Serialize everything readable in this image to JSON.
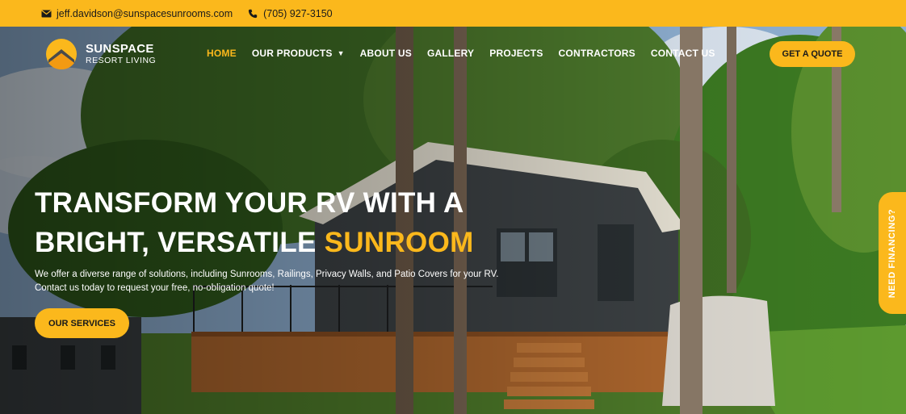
{
  "topbar": {
    "email": "jeff.davidson@sunspacesunrooms.com",
    "phone": "(705) 927-3150",
    "email_icon": "envelope-icon",
    "phone_icon": "phone-icon"
  },
  "logo": {
    "brand": "SUNSPACE",
    "sub": "RESORT LIVING"
  },
  "nav": {
    "items": [
      {
        "label": "HOME"
      },
      {
        "label": "OUR PRODUCTS"
      },
      {
        "label": "ABOUT US"
      },
      {
        "label": "GALLERY"
      },
      {
        "label": "PROJECTS"
      },
      {
        "label": "CONTRACTORS"
      },
      {
        "label": "CONTACT US"
      }
    ],
    "cta": "GET A QUOTE"
  },
  "hero": {
    "headline_line1": "TRANSFORM YOUR RV WITH A",
    "headline_line2_prefix": "BRIGHT, VERSATILE ",
    "headline_accent": "SUNROOM",
    "description": "We offer a diverse range of solutions, including Sunrooms, Railings, Privacy Walls, and Patio Covers for your RV. Contact us today to request your free, no-obligation quote!",
    "button": "OUR SERVICES"
  },
  "financing_tab": "NEED FINANCING?",
  "colors": {
    "accent": "#fbb81c",
    "text_light": "#ffffff"
  }
}
